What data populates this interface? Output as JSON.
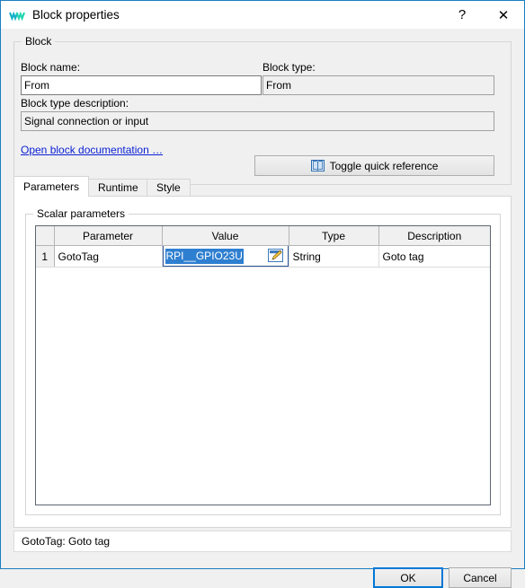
{
  "window": {
    "title": "Block properties",
    "icon": "app-logo-icon",
    "help_label": "?",
    "close_label": "✕",
    "accent_color": "#1a7fc1"
  },
  "block_group": {
    "legend": "Block",
    "block_name_label": "Block name:",
    "block_name_value": "From",
    "block_type_label": "Block type:",
    "block_type_value": "From",
    "block_type_description_label": "Block type description:",
    "block_type_description_value": "Signal connection or input",
    "documentation_link": "Open block documentation …",
    "toggle_quick_reference_label": "Toggle quick reference"
  },
  "tabs": [
    {
      "label": "Parameters",
      "active": true
    },
    {
      "label": "Runtime",
      "active": false
    },
    {
      "label": "Style",
      "active": false
    }
  ],
  "scalar_parameters": {
    "legend": "Scalar parameters",
    "columns": [
      "Parameter",
      "Value",
      "Type",
      "Description"
    ],
    "rows": [
      {
        "number": "1",
        "parameter": "GotoTag",
        "value": "RPI__GPIO23U",
        "value_selected": true,
        "type": "String",
        "description": "Goto tag",
        "edit_icon": "edit-pencil-icon"
      }
    ]
  },
  "status": {
    "text": "GotoTag: Goto tag"
  },
  "dialog_buttons": {
    "ok_label": "OK",
    "cancel_label": "Cancel",
    "ok_focus_color": "#0078d7"
  },
  "colors": {
    "selection_blue": "#2f7fd0",
    "link_blue": "#0a1fd4",
    "window_bg": "#f0f0f0"
  }
}
